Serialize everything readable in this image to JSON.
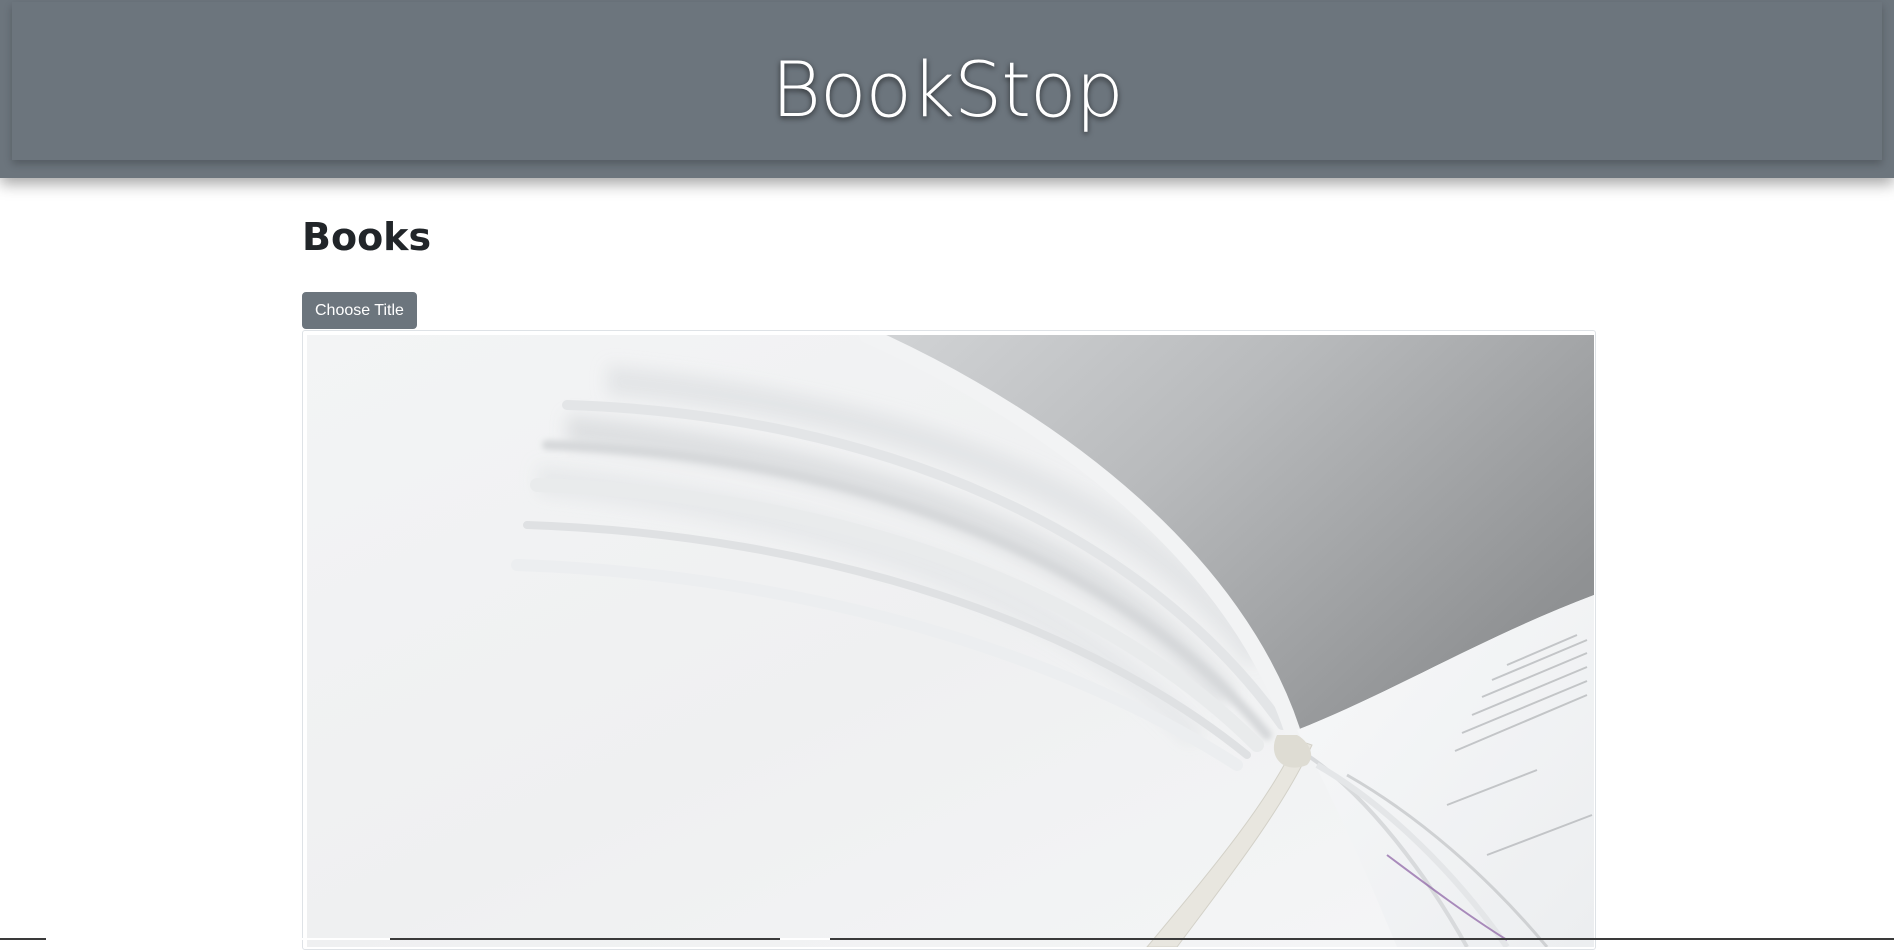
{
  "header": {
    "title": "BookStop"
  },
  "main": {
    "heading": "Books",
    "choose_button_label": "Choose Title"
  },
  "colors": {
    "header_bg": "#6c757d",
    "header_text": "#ffffff",
    "button_bg": "#6c757d",
    "heading_text": "#212529"
  },
  "image": {
    "subject": "open-book-photo"
  }
}
